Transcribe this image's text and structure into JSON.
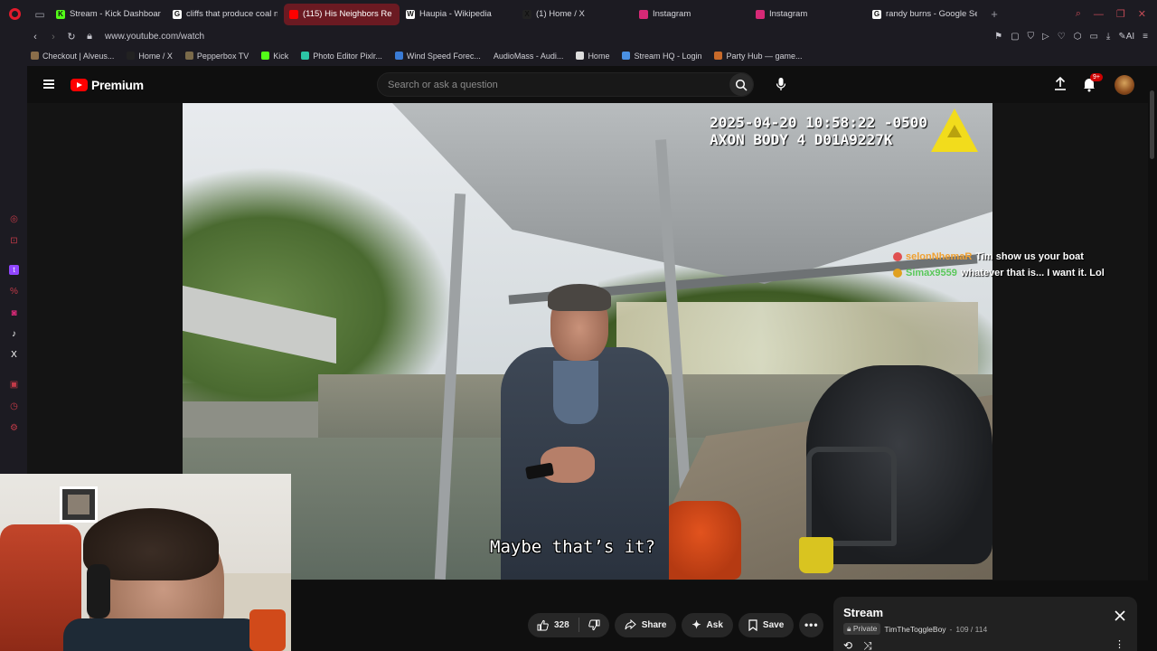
{
  "browser": {
    "tabs": [
      {
        "label": "Stream - Kick Dashboard",
        "color": "#53fc18",
        "glyph": "K"
      },
      {
        "label": "cliffs that produce coal nat",
        "color": "#ffffff",
        "glyph": "G"
      },
      {
        "label": "(115) His Neighbors Re",
        "color": "#ff0000",
        "glyph": "",
        "active": true
      },
      {
        "label": "Haupia - Wikipedia",
        "color": "#ffffff",
        "glyph": "W"
      },
      {
        "label": "(1) Home / X",
        "color": "#222222",
        "glyph": "X"
      },
      {
        "label": "Instagram",
        "color": "#d62976",
        "glyph": ""
      },
      {
        "label": "Instagram",
        "color": "#d62976",
        "glyph": ""
      },
      {
        "label": "randy burns - Google Searc",
        "color": "#ffffff",
        "glyph": "G"
      }
    ],
    "url": "www.youtube.com/watch",
    "bookmarks": [
      {
        "label": "Checkout | Alveus...",
        "color": "#8a6d4a"
      },
      {
        "label": "Home / X",
        "color": "#222222"
      },
      {
        "label": "Pepperbox TV",
        "color": "#7a6a4a"
      },
      {
        "label": "Kick",
        "color": "#53fc18"
      },
      {
        "label": "Photo Editor Pixlr...",
        "color": "#2cc5a6"
      },
      {
        "label": "Wind Speed Forec...",
        "color": "#3a7bd5"
      },
      {
        "label": "AudioMass - Audi...",
        "color": ""
      },
      {
        "label": "Home",
        "color": "#dddddd"
      },
      {
        "label": "Stream HQ - Login",
        "color": "#4a90e2"
      },
      {
        "label": "Party Hub — game...",
        "color": "#c86a2a"
      }
    ]
  },
  "youtube": {
    "brand": "Premium",
    "search_placeholder": "Search or ask a question",
    "notification_count": "9+"
  },
  "video": {
    "timestamp": "2025-04-20 10:58:22 -0500",
    "device": "AXON BODY 4 D01A9227K",
    "caption": "Maybe that’s it?"
  },
  "chat": [
    {
      "user": "selonNhemaR",
      "user_color": "#f0a030",
      "badge_color": "#e05050",
      "message": "Tim show us your boat"
    },
    {
      "user": "Simax9559",
      "user_color": "#5ac85a",
      "badge_color": "#e0a020",
      "message": "whatever that is... I want it. Lol"
    }
  ],
  "actions": {
    "like_count": "328",
    "share_label": "Share",
    "ask_label": "Ask",
    "save_label": "Save"
  },
  "playlist": {
    "title": "Stream",
    "privacy": "Private",
    "owner": "TimTheToggleBoy",
    "position": "109 / 114"
  }
}
